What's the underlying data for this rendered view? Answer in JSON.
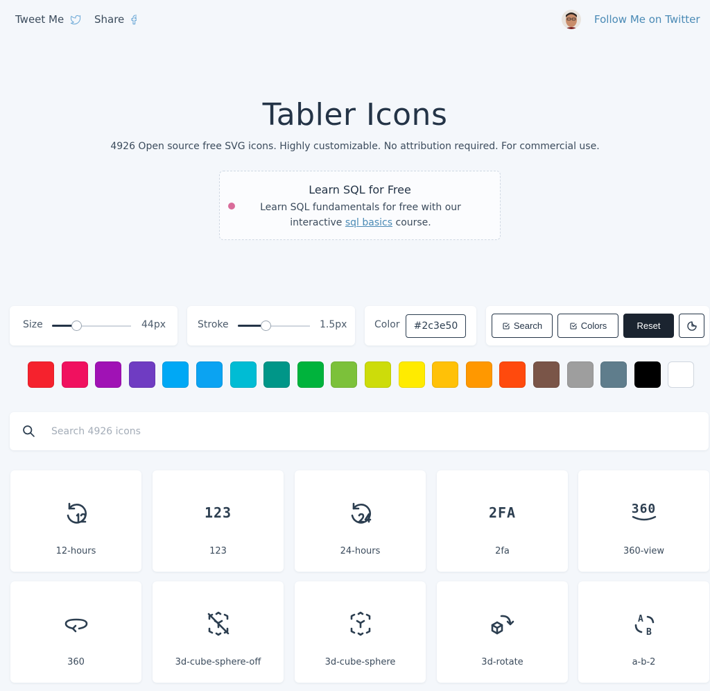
{
  "header": {
    "tweet_label": "Tweet Me",
    "share_label": "Share",
    "follow_label": "Follow Me on Twitter"
  },
  "hero": {
    "title": "Tabler Icons",
    "subtitle": "4926 Open source free SVG icons. Highly customizable. No attribution required. For commercial use."
  },
  "ad": {
    "title": "Learn SQL for Free",
    "text_before": "Learn SQL fundamentals for free with our interactive ",
    "link": "sql basics",
    "text_after": " course."
  },
  "controls": {
    "size_label": "Size",
    "size_value": "44px",
    "size_level": 0.31,
    "stroke_label": "Stroke",
    "stroke_value": "1.5px",
    "stroke_level": 0.38,
    "color_label": "Color",
    "color_value": "#2c3e50",
    "search_button": "Search",
    "colors_button": "Colors",
    "reset_button": "Reset"
  },
  "swatches": [
    "#f5222d",
    "#f0115f",
    "#a012b5",
    "#6f3cc2",
    "#00a8f5",
    "#0ba3f2",
    "#00bcd4",
    "#009688",
    "#00b33c",
    "#7cc13a",
    "#cddc0a",
    "#ffeb00",
    "#ffc107",
    "#ff9800",
    "#ff4a0d",
    "#7a5548",
    "#9e9e9e",
    "#5f7d8c",
    "#000000",
    "#ffffff"
  ],
  "search": {
    "placeholder": "Search 4926 icons"
  },
  "icons": [
    {
      "name": "12-hours",
      "icon": "history-12-icon"
    },
    {
      "name": "123",
      "icon": "numbers-123-icon",
      "glyph": "123"
    },
    {
      "name": "24-hours",
      "icon": "history-24-icon"
    },
    {
      "name": "2fa",
      "icon": "2fa-icon",
      "glyph": "2FA"
    },
    {
      "name": "360-view",
      "icon": "360-view-icon",
      "glyph": "360"
    },
    {
      "name": "360",
      "icon": "rotate-360-icon"
    },
    {
      "name": "3d-cube-sphere-off",
      "icon": "cube-sphere-off-icon"
    },
    {
      "name": "3d-cube-sphere",
      "icon": "cube-sphere-icon"
    },
    {
      "name": "3d-rotate",
      "icon": "3d-rotate-icon"
    },
    {
      "name": "a-b-2",
      "icon": "a-b-2-icon",
      "glyph_a": "A",
      "glyph_b": "B"
    }
  ]
}
